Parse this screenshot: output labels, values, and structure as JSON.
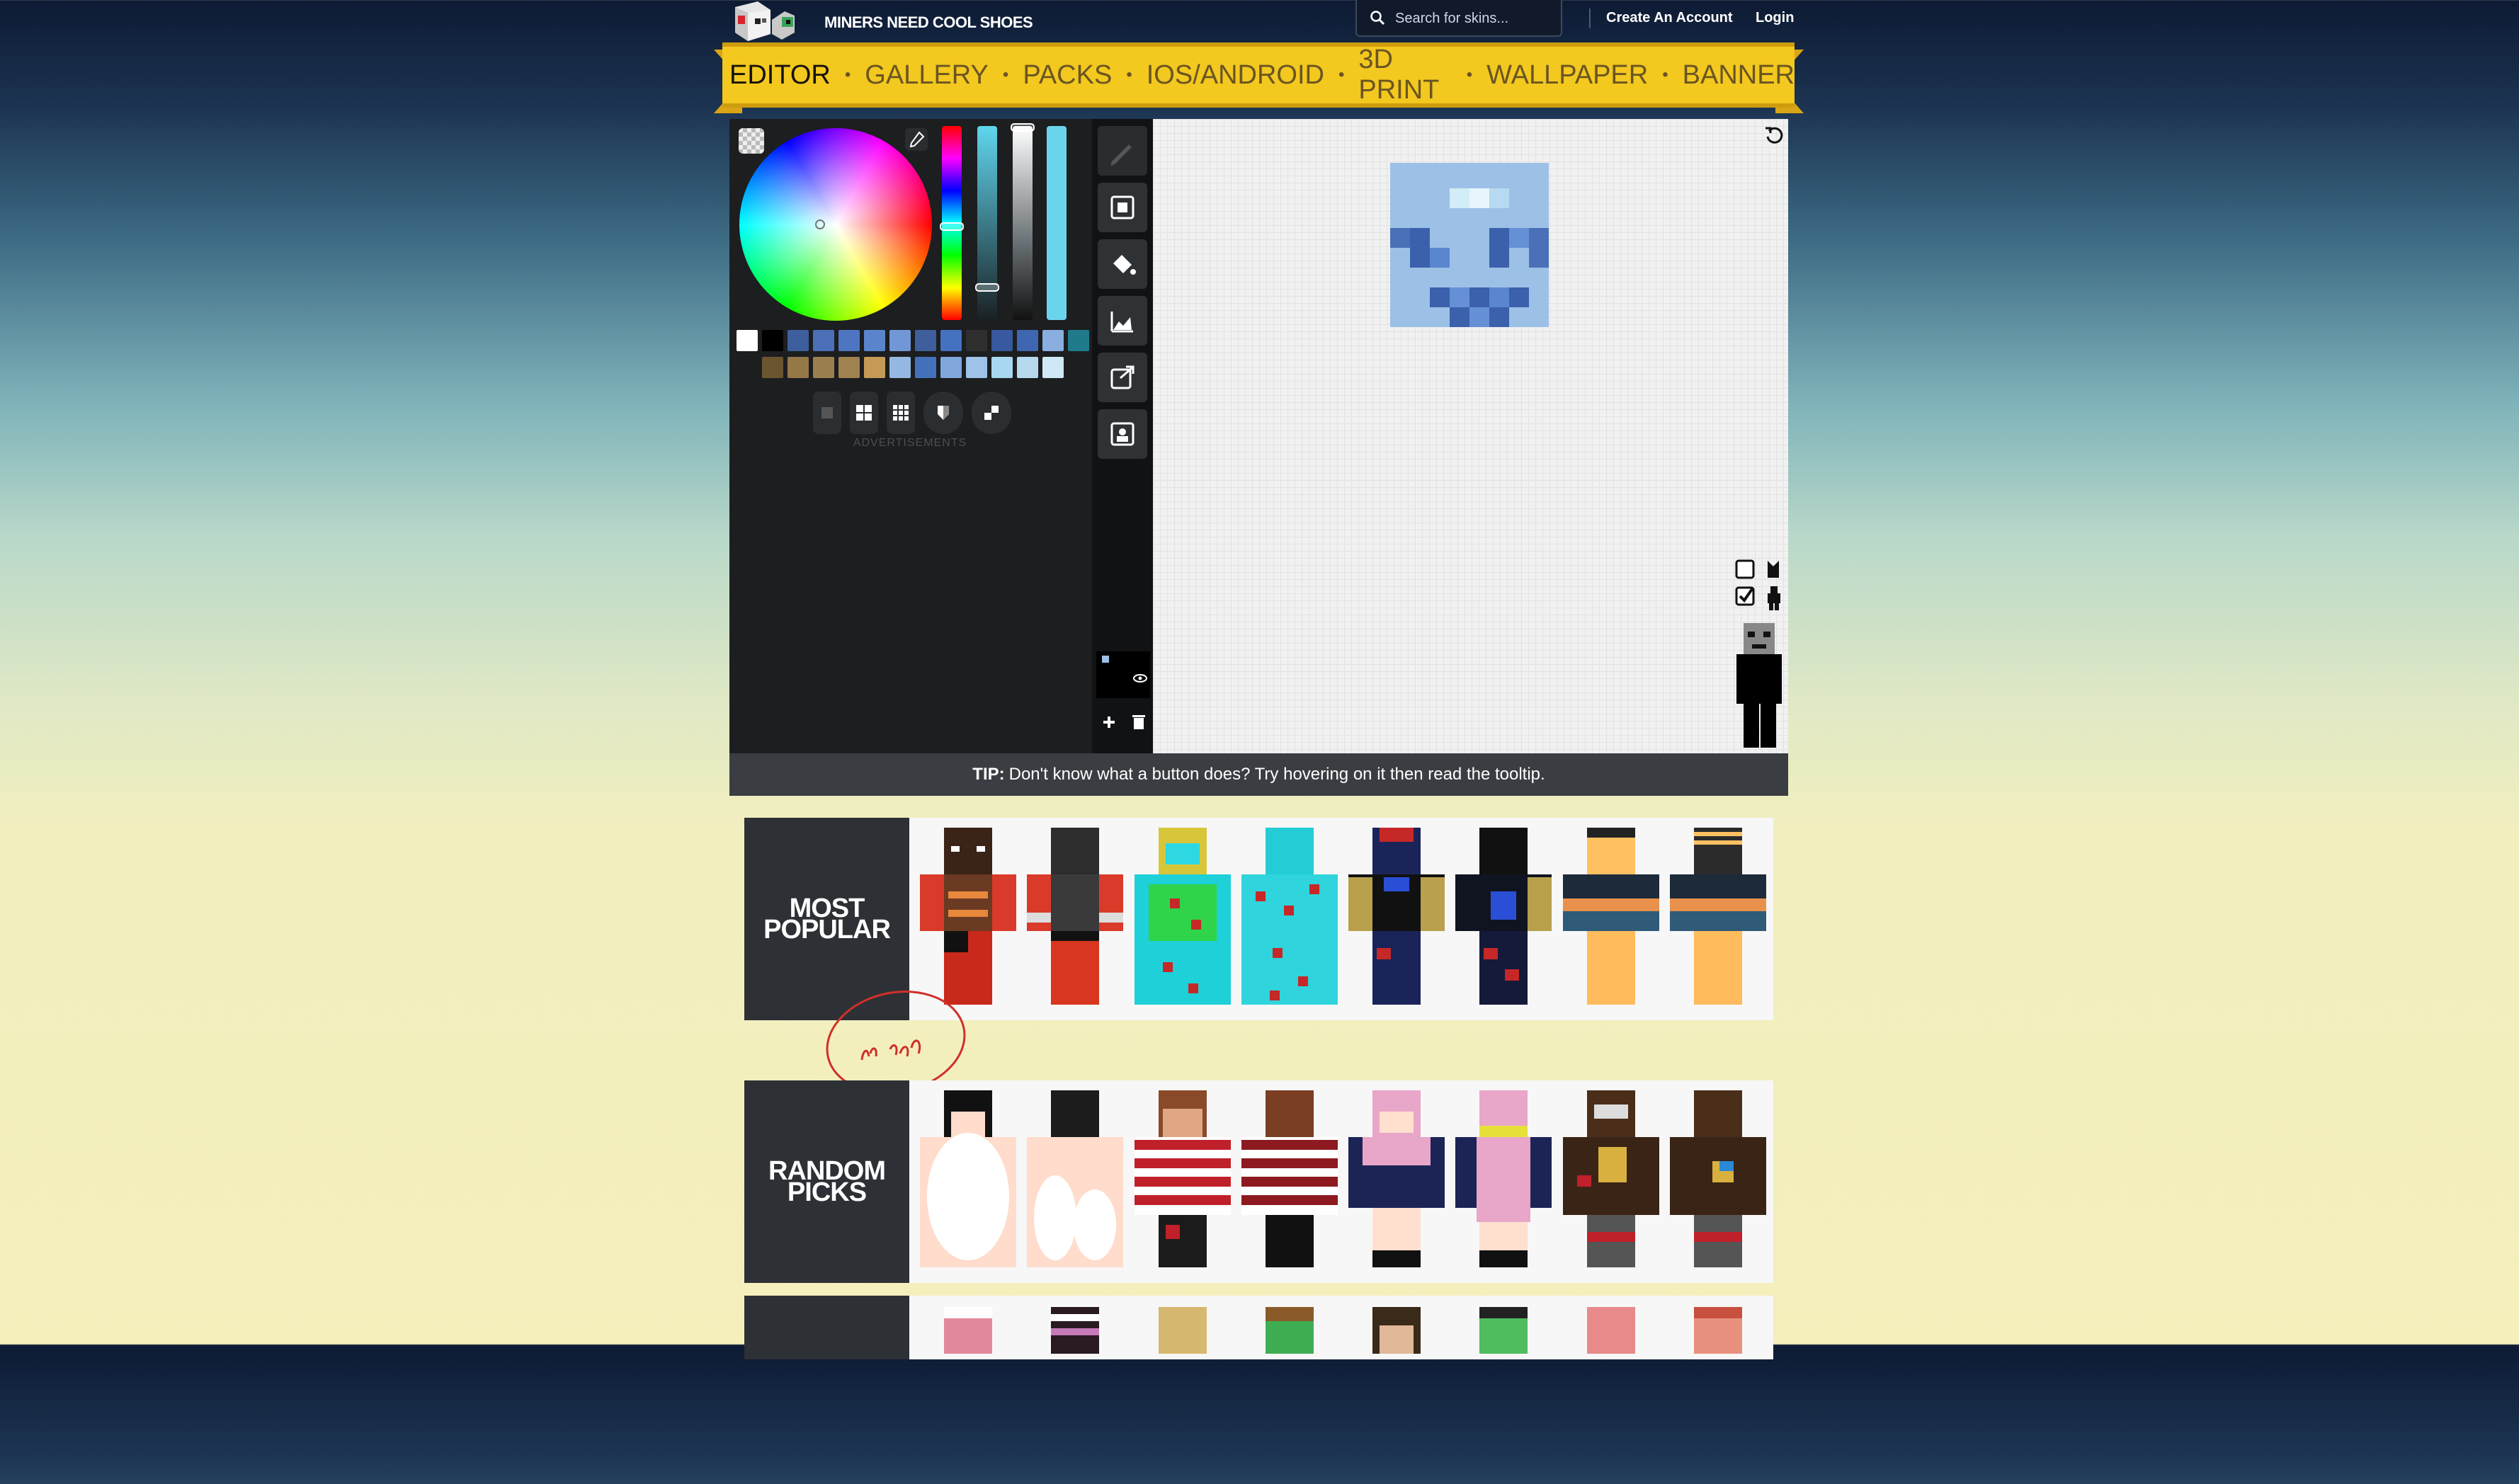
{
  "header": {
    "site_name": "MINERS NEED COOL SHOES",
    "search_placeholder": "Search for skins...",
    "create_account": "Create An Account",
    "login": "Login"
  },
  "nav": {
    "items": [
      "EDITOR",
      "GALLERY",
      "PACKS",
      "IOS/ANDROID",
      "3D PRINT",
      "WALLPAPER",
      "BANNER"
    ],
    "active": "EDITOR"
  },
  "editor": {
    "advertisements_label": "ADVERTISEMENTS",
    "swatches_row1": [
      "#ffffff",
      "#000000",
      "#3d5f9e",
      "#4b70b8",
      "#4e75c2",
      "#5a85cc",
      "#7197d6",
      "#3e5f9c",
      "#4472c0",
      "#2f2f2f",
      "#3858a0",
      "#3f66b0",
      "#8aaee0",
      "#1f7b8c"
    ],
    "swatches_row2": [
      "#6b5530",
      "#957848",
      "#9c7f4f",
      "#a08250",
      "#c49a55",
      "#94b8e2",
      "#4372bb",
      "#81a8dc",
      "#9ec2ea",
      "#a8d8f0",
      "#b6d9ee",
      "#cfe8f6"
    ],
    "tools_on_toolbar": [
      "pencil-icon",
      "select-icon",
      "bucket-icon",
      "noise-icon",
      "export-icon",
      "avatar-icon"
    ]
  },
  "tip": {
    "prefix": "TIP:",
    "text": "Don't know what a button does? Try hovering on it then read the tooltip."
  },
  "galleries": {
    "most_popular": {
      "label_line1": "MOST",
      "label_line2": "POPULAR"
    },
    "random_picks": {
      "label_line1": "RANDOM",
      "label_line2": "PICKS"
    }
  }
}
